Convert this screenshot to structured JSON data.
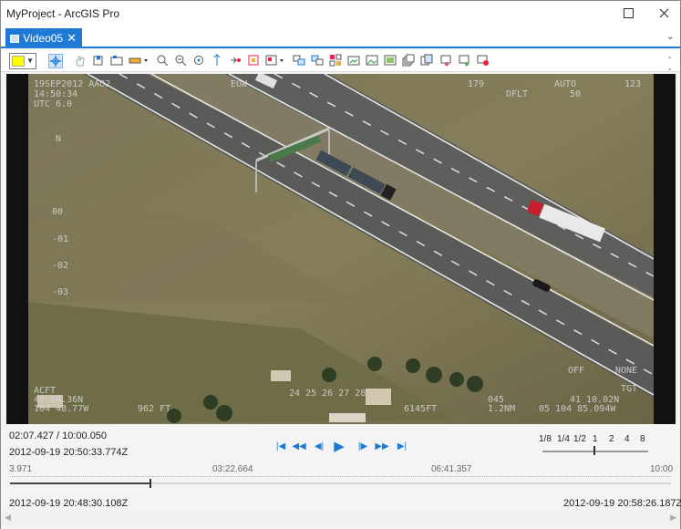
{
  "window": {
    "title": "MyProject - ArcGIS Pro"
  },
  "tab": {
    "label": "Video05"
  },
  "toolbar": {
    "highlight_color": "#ffff00"
  },
  "overlay": {
    "top_left_1": "19SEP2012  AAO2",
    "top_left_2": "14:50:34",
    "top_left_3": "UTC 6.0",
    "top_center": "EOW",
    "top_mid_1": "179",
    "top_mid_2": "DFLT",
    "top_mid_3": "50",
    "top_right_1": "AUTO",
    "top_right_2": "123",
    "north": "N",
    "scale_1": "00",
    "scale_2": "-01",
    "scale_3": "-02",
    "scale_4": "-03",
    "bl_1": "ACFT",
    "bl_2": "41 00.36N",
    "bl_3": "104 48.77W",
    "bl_4": "962 FT",
    "bottom_ticks": "24  25  26  27  28",
    "bottom_center": "6145FT",
    "br_1": "045",
    "br_2": "1.2NM",
    "br_3": "41 10.02N",
    "br_4": "05 104 85.094W",
    "tgt": "TGT",
    "off": "OFF",
    "none": "NONE"
  },
  "playback": {
    "position": "02:07.427 / 10:00.050",
    "current_datetime": "2012-09-19 20:50:33.774Z",
    "start_datetime": "2012-09-19 20:48:30.108Z",
    "end_datetime": "2012-09-19 20:58:26.187Z",
    "progress_fraction": 0.212,
    "rates": [
      "1/8",
      "1/4",
      "1/2",
      "1",
      "2",
      "4",
      "8"
    ],
    "selected_rate": "1",
    "time_ticks": [
      "3.971",
      "03:22.664",
      "06:41.357",
      "10:00"
    ]
  }
}
